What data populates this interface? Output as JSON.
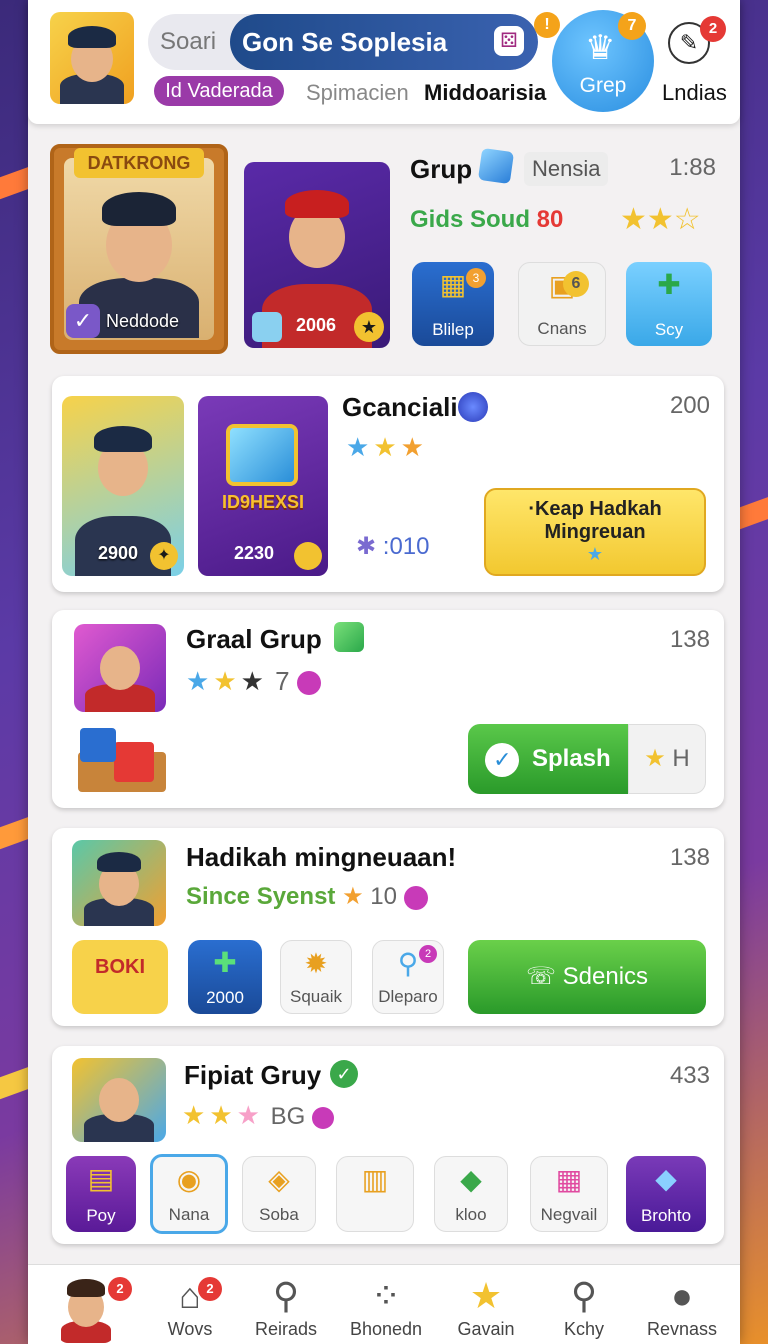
{
  "header": {
    "search_prefix": "Soari",
    "search_value": "Gon Se Soplesia",
    "search_badge": "!",
    "tag_label": "Id Vaderada",
    "link_1": "Spimacien",
    "link_2": "Middoarisia",
    "grep_label": "Grep",
    "grep_badge": "7",
    "pen_badge": "2",
    "pen_label": "Lndias"
  },
  "hero": {
    "frame_banner": "DATKRONG",
    "frame_name": "Neddode",
    "card_value": "2006",
    "title": "Grup",
    "tag": "Nensia",
    "time": "1:88",
    "subtitle_text": "Gids Soud",
    "subtitle_num": "80",
    "tiles": [
      "Blilep",
      "Cnans",
      "Scy"
    ],
    "tile_coin": "6",
    "tile_badge": "3"
  },
  "card2": {
    "title": "Gcanciali",
    "count": "200",
    "pic1_value": "2900",
    "pic2_banner": "ID9HEXSI",
    "pic2_value": "2230",
    "stat": ":010",
    "button_line1": "·Keap Hadkah",
    "button_line2": "Mingreuan"
  },
  "card3": {
    "title": "Graal Grup",
    "count": "138",
    "star_count": "7",
    "button_label": "Splash",
    "button_side": "H"
  },
  "card4": {
    "title": "Hadikah mingneuaan!",
    "count": "138",
    "subtitle": "Since Syenst",
    "sub_num": "10",
    "tiles": [
      "BOKI",
      "2000",
      "Squaik",
      "Dleparo"
    ],
    "tile_badge": "2",
    "button_label": "Sdenics"
  },
  "card5": {
    "title": "Fipiat Gruy",
    "count": "433",
    "star_text": "BG",
    "tiles": [
      "Poy",
      "Nana",
      "Soba",
      "",
      "kloo",
      "Negvail",
      "Brohto"
    ]
  },
  "nav": {
    "items": [
      "",
      "Wovs",
      "Reirads",
      "Bhonedn",
      "Gavain",
      "Kchy",
      "Revnass"
    ],
    "badge_1": "2",
    "badge_2": "2"
  }
}
